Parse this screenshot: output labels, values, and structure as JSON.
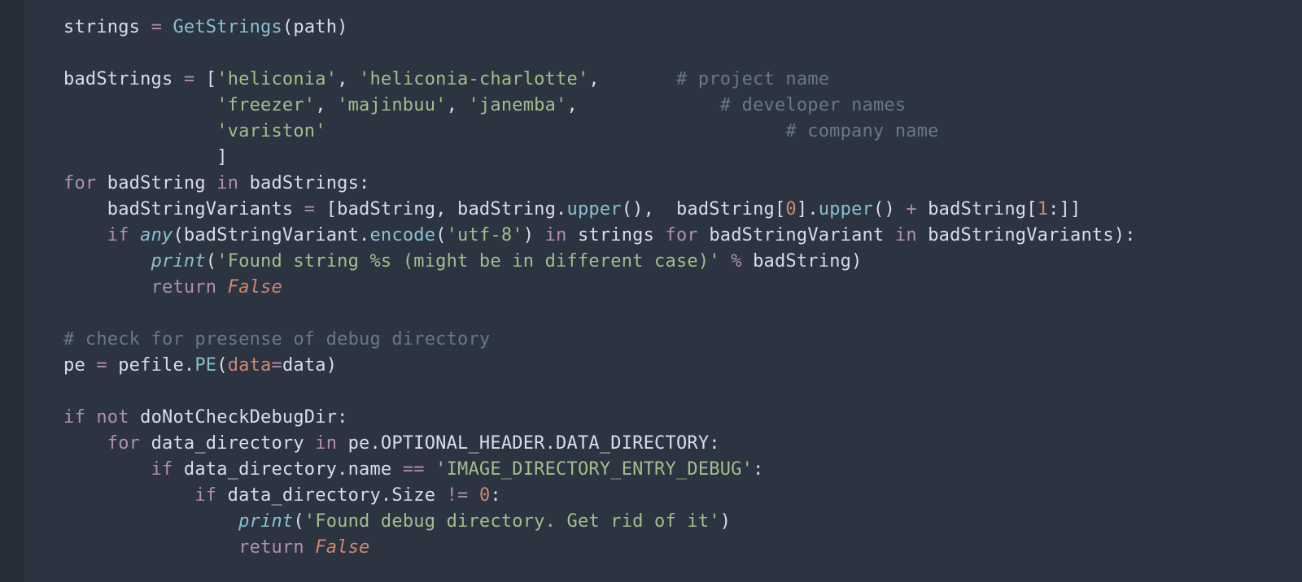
{
  "theme": {
    "background": "#2b3440",
    "gutter": "#262e39",
    "plain": "#d8dee9",
    "keyword": "#b48ead",
    "func": "#88c0d0",
    "string": "#a3be8c",
    "number": "#d08770",
    "comment": "#6b7785"
  },
  "language": "python",
  "code_tokens": {
    "l1": {
      "a": "strings ",
      "b": "=",
      "c": " ",
      "d": "GetStrings",
      "e": "(",
      "f": "path",
      "g": ")"
    },
    "l3": {
      "a": "badStrings ",
      "b": "=",
      "c": " [",
      "s1": "'heliconia'",
      "d": ", ",
      "s2": "'heliconia-charlotte'",
      "e": ",",
      "pad": "       ",
      "cm": "# project name"
    },
    "l4": {
      "pad": "              ",
      "s1": "'freezer'",
      "a": ", ",
      "s2": "'majinbuu'",
      "b": ", ",
      "s3": "'janemba'",
      "c": ",",
      "pad2": "             ",
      "cm": "# developer names"
    },
    "l5": {
      "pad": "              ",
      "s1": "'variston'",
      "pad2": "                                          ",
      "cm": "# company name"
    },
    "l6": {
      "pad": "              ",
      "a": "]"
    },
    "l7": {
      "a": "for",
      "b": " badString ",
      "c": "in",
      "d": " badStrings:"
    },
    "l8": {
      "ind": "    ",
      "a": "badStringVariants ",
      "b": "=",
      "c": " [badString, badString.",
      "d": "upper",
      "e": "(),  badString[",
      "n0": "0",
      "f": "].",
      "g": "upper",
      "h": "() ",
      "i": "+",
      "j": " badString[",
      "n1": "1",
      "k": ":]]"
    },
    "l9": {
      "ind": "    ",
      "a": "if",
      "b": " ",
      "c": "any",
      "d": "(badStringVariant.",
      "e": "encode",
      "f": "(",
      "s": "'utf-8'",
      "g": ") ",
      "h": "in",
      "i": " strings ",
      "j": "for",
      "k": " badStringVariant ",
      "l": "in",
      "m": " badStringVariants):"
    },
    "l10": {
      "ind": "        ",
      "a": "print",
      "b": "(",
      "s": "'Found string %s (might be in different case)'",
      "c": " ",
      "d": "%",
      "e": " badString)"
    },
    "l11": {
      "ind": "        ",
      "a": "return",
      "b": " ",
      "c": "False"
    },
    "l13": {
      "a": "# check for presense of debug directory"
    },
    "l14": {
      "a": "pe ",
      "b": "=",
      "c": " pefile.",
      "d": "PE",
      "e": "(",
      "f": "data",
      "g": "=",
      "h": "data)"
    },
    "l16": {
      "a": "if",
      "b": " ",
      "c": "not",
      "d": " doNotCheckDebugDir:"
    },
    "l17": {
      "ind": "    ",
      "a": "for",
      "b": " data_directory ",
      "c": "in",
      "d": " pe.OPTIONAL_HEADER.DATA_DIRECTORY:"
    },
    "l18": {
      "ind": "        ",
      "a": "if",
      "b": " data_directory.name ",
      "c": "==",
      "d": " ",
      "s": "'IMAGE_DIRECTORY_ENTRY_DEBUG'",
      "e": ":"
    },
    "l19": {
      "ind": "            ",
      "a": "if",
      "b": " data_directory.Size ",
      "c": "!=",
      "d": " ",
      "n": "0",
      "e": ":"
    },
    "l20": {
      "ind": "                ",
      "a": "print",
      "b": "(",
      "s": "'Found debug directory. Get rid of it'",
      "c": ")"
    },
    "l21": {
      "ind": "                ",
      "a": "return",
      "b": " ",
      "c": "False"
    }
  }
}
